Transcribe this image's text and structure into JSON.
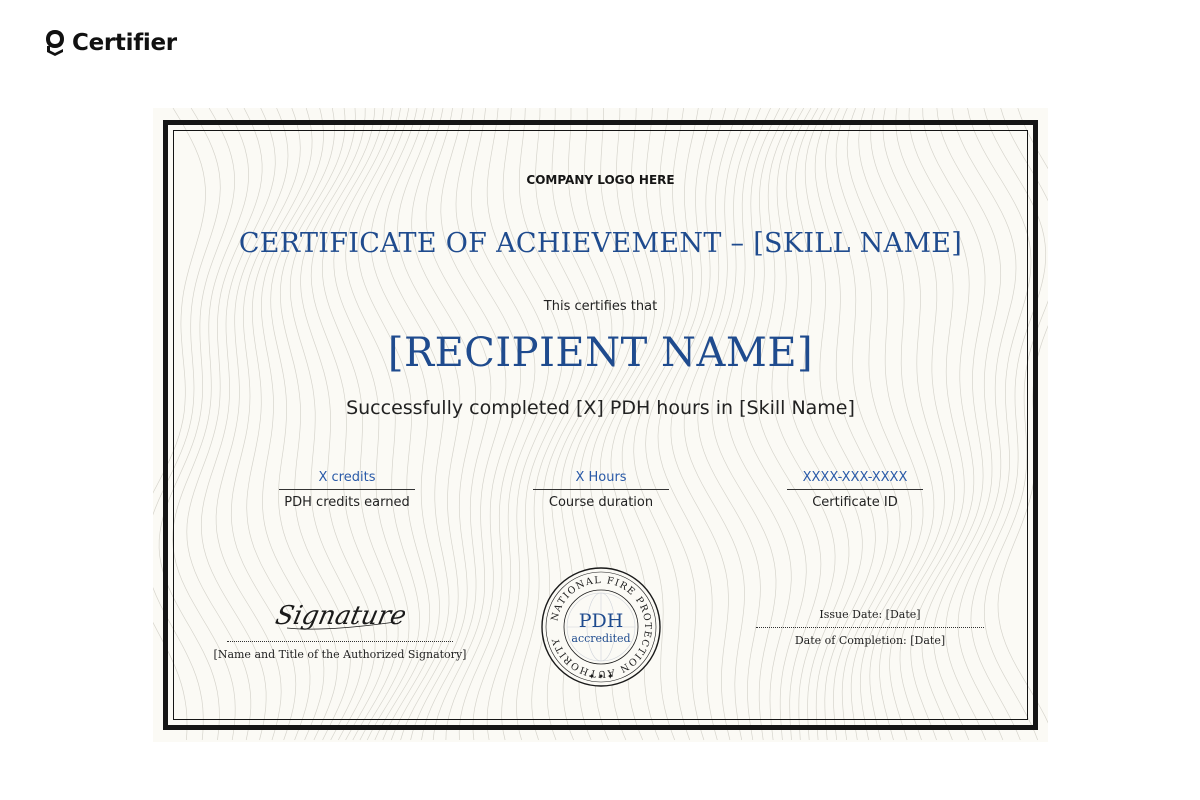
{
  "brand": {
    "name": "Certifier"
  },
  "certificate": {
    "logo_placeholder": "COMPANY LOGO HERE",
    "title": "CERTIFICATE OF ACHIEVEMENT – [SKILL NAME]",
    "certifies_text": "This certifies that",
    "recipient": "[RECIPIENT NAME]",
    "completion_text": "Successfully completed [X] PDH hours in [Skill Name]",
    "stats": [
      {
        "value": "X credits",
        "label": "PDH credits earned"
      },
      {
        "value": "X Hours",
        "label": "Course duration"
      },
      {
        "value": "XXXX-XXX-XXXX",
        "label": "Certificate ID"
      }
    ],
    "signature": {
      "script": "Signature",
      "caption": "[Name and Title of the Authorized Signatory]"
    },
    "seal": {
      "ring_text": "NATIONAL FIRE PROTECTION AUTHORITY",
      "main": "PDH",
      "sub": "accredited"
    },
    "issue_date": "Issue Date: [Date]",
    "completion_date": "Date of Completion: [Date]"
  },
  "colors": {
    "accent": "#1f4b8e",
    "ink": "#151515",
    "paper": "#fbfaf5"
  }
}
